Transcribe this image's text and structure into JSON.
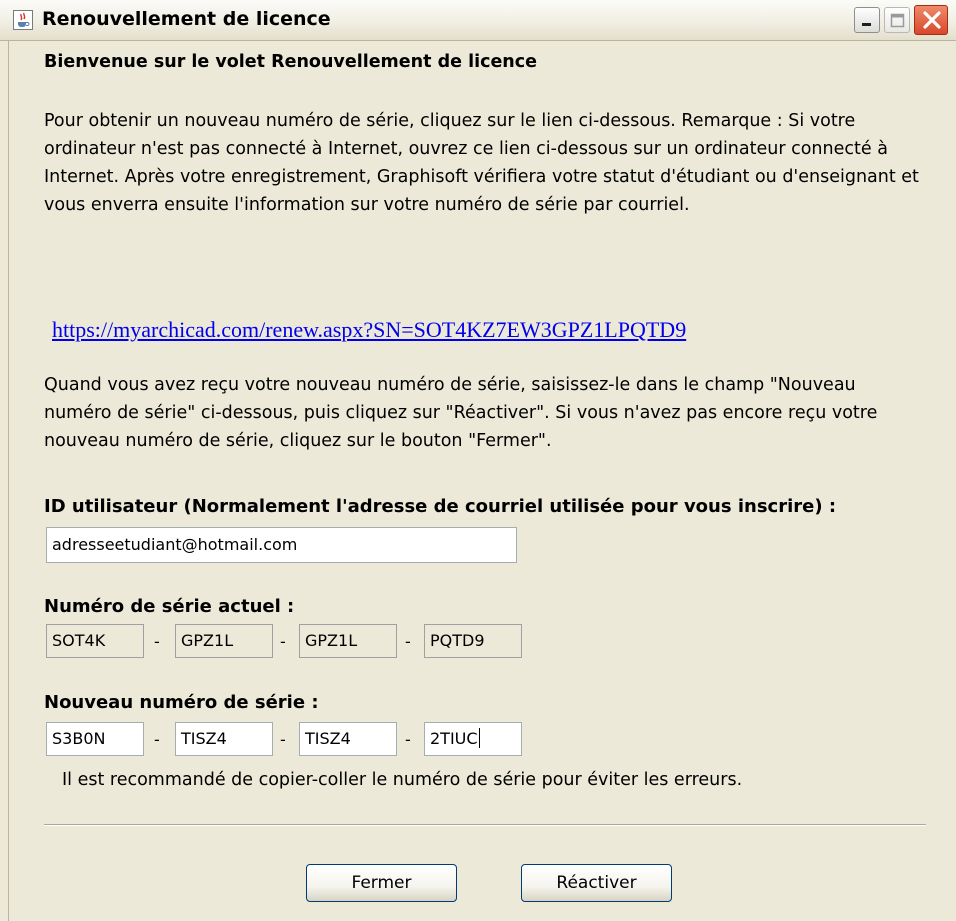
{
  "window": {
    "title": "Renouvellement de licence",
    "app_icon": "java-cup-icon",
    "controls": [
      "minimize-icon",
      "maximize-icon",
      "close-icon"
    ]
  },
  "content": {
    "heading": "Bienvenue sur le volet Renouvellement de licence",
    "intro": "Pour obtenir un nouveau numéro de série, cliquez sur le lien ci-dessous. Remarque : Si votre ordinateur n'est pas connecté à Internet, ouvrez ce lien ci-dessous sur un ordinateur connecté à  Internet. Après votre enregistrement, Graphisoft vérifiera votre statut d'étudiant ou d'enseignant et vous enverra ensuite l'information sur votre numéro de série par courriel.",
    "renew_link": "https://myarchicad.com/renew.aspx?SN=SOT4KZ7EW3GPZ1LPQTD9",
    "instructions": "Quand vous avez reçu votre nouveau numéro de série, saisissez-le dans le champ \"Nouveau numéro de série\" ci-dessous, puis cliquez sur \"Réactiver\". Si vous n'avez pas encore reçu votre nouveau numéro de série, cliquez sur le bouton \"Fermer\"."
  },
  "user_id": {
    "label": "ID utilisateur (Normalement l'adresse de courriel utilisée pour vous inscrire) :",
    "value": "adresseetudiant@hotmail.com"
  },
  "current_serial": {
    "label": "Numéro de série actuel :",
    "parts": [
      "SOT4K",
      "GPZ1L",
      "GPZ1L",
      "PQTD9"
    ],
    "separator": "-"
  },
  "new_serial": {
    "label": "Nouveau numéro de série :",
    "parts": [
      "S3B0N",
      "TISZ4",
      "TISZ4",
      "2TIUC"
    ],
    "separator": "-"
  },
  "note": "Il est recommandé de copier-coller le numéro de série pour éviter les erreurs.",
  "buttons": {
    "close": "Fermer",
    "reactivate": "Réactiver"
  },
  "colors": {
    "dialog_bg": "#ece9d8",
    "link": "#0000ee",
    "close_button": "#d9472b"
  }
}
